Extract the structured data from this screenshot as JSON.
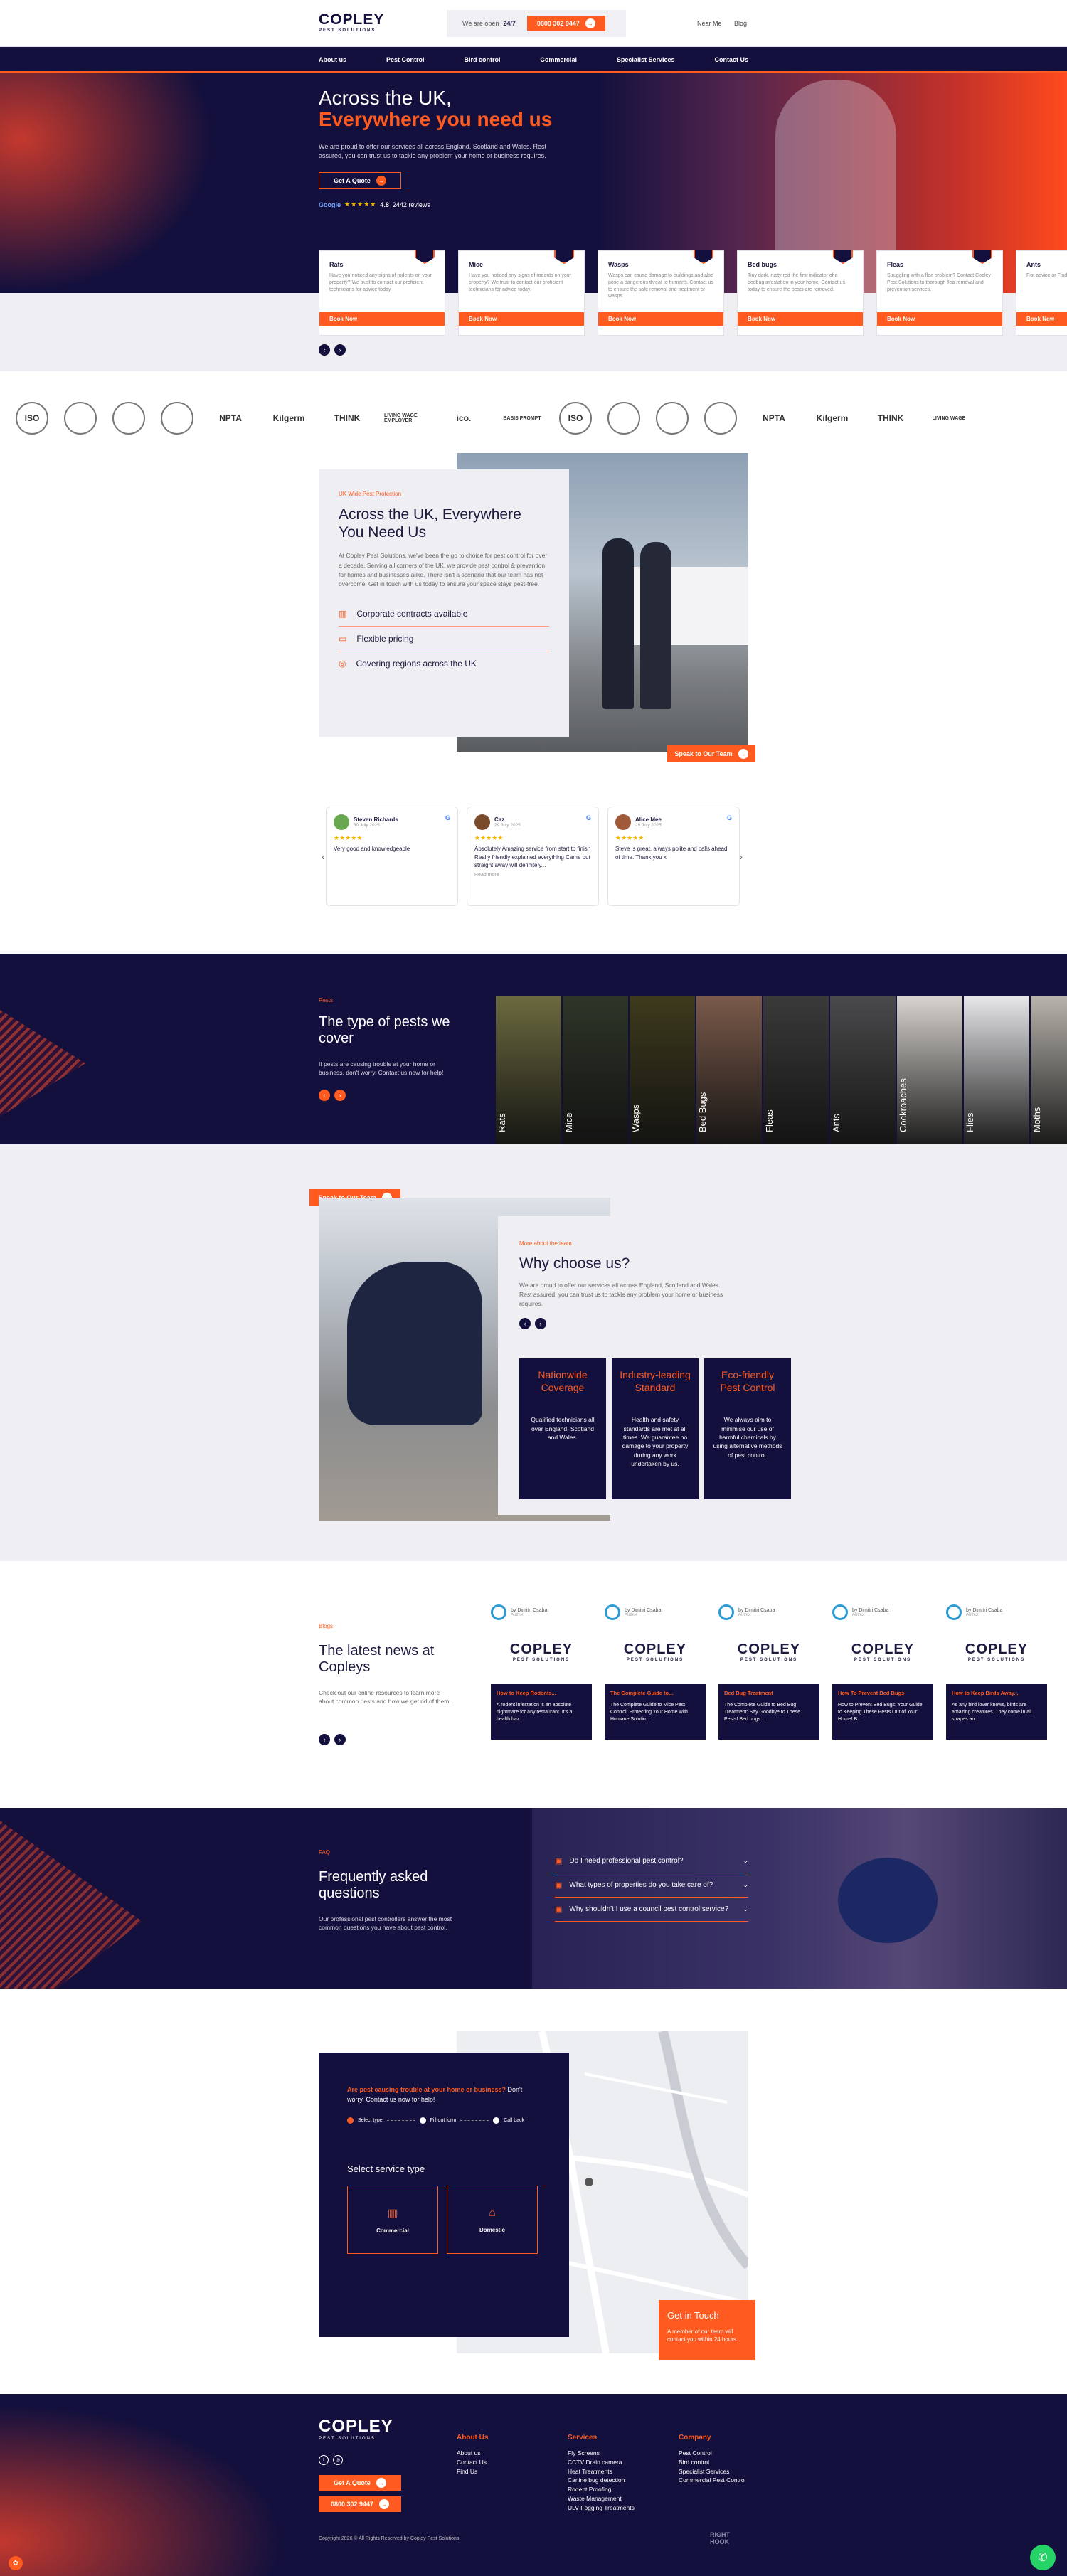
{
  "header": {
    "logo": "COPLEY",
    "logo_sub": "PEST SOLUTIONS",
    "open_pre": "We are open",
    "open_hours": "24/7",
    "phone": "0800 302 9447",
    "links": [
      "Near Me",
      "Blog"
    ]
  },
  "nav": [
    "About us",
    "Pest Control",
    "Bird control",
    "Commercial",
    "Specialist Services",
    "Contact Us"
  ],
  "hero": {
    "line1": "Across the UK,",
    "line2": "Everywhere you need us",
    "text": "We are proud to offer our services all across England, Scotland and Wales. Rest assured, you can trust us to tackle any problem your home or business requires.",
    "cta": "Get A Quote",
    "g": "Google",
    "rating": "4.8",
    "reviews": "2442 reviews"
  },
  "pest_cards": [
    {
      "title": "Rats",
      "text": "Have you noticed any signs of rodents on your property? We trust to contact our proficient technicians for advice today.",
      "btn": "Book Now"
    },
    {
      "title": "Mice",
      "text": "Have you noticed any signs of rodents on your property? We trust to contact our proficient technicians for advice today.",
      "btn": "Book Now"
    },
    {
      "title": "Wasps",
      "text": "Wasps can cause damage to buildings and also pose a dangerous threat to humans. Contact us to ensure the safe removal and treatment of wasps.",
      "btn": "Book Now"
    },
    {
      "title": "Bed bugs",
      "text": "Tiny dark, rusty red the first indicator of a bedbug infestation in your home. Contact us today to ensure the pests are removed.",
      "btn": "Book Now"
    },
    {
      "title": "Fleas",
      "text": "Struggling with a flea problem? Contact Copley Pest Solutions to thorough flea removal and prevention services.",
      "btn": "Book Now"
    },
    {
      "title": "Ants",
      "text": "Fist advice or Find your spac ants.",
      "btn": "Book Now"
    }
  ],
  "accreditations": [
    "ISO",
    "",
    "",
    "",
    "NPTA",
    "Kilgerm",
    "THINK",
    "LIVING WAGE EMPLOYER",
    "ico.",
    "BASIS PROMPT",
    "ISO",
    "",
    "",
    "",
    "NPTA",
    "Kilgerm",
    "THINK",
    "LIVING WAGE"
  ],
  "about": {
    "kicker": "UK Wide Pest Protection",
    "title": "Across the UK, Everywhere You Need Us",
    "text": "At Copley Pest Solutions, we've been the go to choice for pest control for over a decade. Serving all corners of the UK, we provide pest control & prevention for homes and businesses alike. There isn't a scenario that our team has not overcome. Get in touch with us today to ensure your space stays pest-free.",
    "features": [
      "Corporate contracts available",
      "Flexible pricing",
      "Covering regions across the UK"
    ],
    "cta": "Speak to Our Team"
  },
  "reviews": [
    {
      "name": "Steven Richards",
      "date": "30 July 2025",
      "text": "Very good and knowledgeable",
      "more": ""
    },
    {
      "name": "Caz",
      "date": "29 July 2025",
      "text": "Absolutely Amazing service from start to finish Really friendly explained everything Came out straight away will definitely...",
      "more": "Read more"
    },
    {
      "name": "Alice Mee",
      "date": "29 July 2025",
      "text": "Steve is great, always polite and calls ahead of time. Thank you x",
      "more": ""
    }
  ],
  "pests": {
    "kicker": "Pests",
    "title": "The type of pests we cover",
    "text": "If pests are causing trouble at your home or business, don't worry. Contact us now for help!",
    "items": [
      "Rats",
      "Mice",
      "Wasps",
      "Bed Bugs",
      "Fleas",
      "Ants",
      "Cockroaches",
      "Flies",
      "Moths"
    ]
  },
  "why": {
    "kicker": "More about the team",
    "title": "Why choose us?",
    "text": "We are proud to offer our services all across England, Scotland and Wales. Rest assured, you can trust us to tackle any problem your home or business requires.",
    "cta": "Speak to Our Team",
    "cards": [
      {
        "title": "Nationwide Coverage",
        "text": "Qualified technicians all over England, Scotland and Wales."
      },
      {
        "title": "Industry-leading Standard",
        "text": "Health and safety standards are met at all times. We guarantee no damage to your property during any work undertaken by us."
      },
      {
        "title": "Eco-friendly Pest Control",
        "text": "We always aim to minimise our use of harmful chemicals by using alternative methods of pest control."
      }
    ]
  },
  "blog": {
    "kicker": "Blogs",
    "title": "The latest news at Copleys",
    "text": "Check out our online resources to learn more about common pests and how we get rid of them.",
    "posts": [
      {
        "author": "by Dimitri Csaba",
        "role": "Author",
        "title": "How to Keep Rodents...",
        "text": "A rodent infestation is an absolute nightmare for any restaurant. It's a health haz..."
      },
      {
        "author": "by Dimitri Csaba",
        "role": "Author",
        "title": "The Complete Guide to...",
        "text": "The Complete Guide to Mice Pest Control: Protecting Your Home with Humane Solutio..."
      },
      {
        "author": "by Dimitri Csaba",
        "role": "Author",
        "title": "Bed Bug Treatment",
        "text": "The Complete Guide to Bed Bug Treatment: Say Goodbye to These Pests! Bed bugs ..."
      },
      {
        "author": "by Dimitri Csaba",
        "role": "Author",
        "title": "How To Prevent Bed Bugs",
        "text": "How to Prevent Bed Bugs: Your Guide to Keeping These Pests Out of Your Home! B..."
      },
      {
        "author": "by Dimitri Csaba",
        "role": "Author",
        "title": "How to Keep Birds Away...",
        "text": "As any bird lover knows, birds are amazing creatures. They come in all shapes an..."
      }
    ]
  },
  "faq": {
    "kicker": "FAQ",
    "title": "Frequently asked questions",
    "text": "Our professional pest controllers answer the most common questions you have about pest control.",
    "items": [
      "Do I need professional pest control?",
      "What types of properties do you take care of?",
      "Why shouldn't I use a council pest control service?"
    ]
  },
  "contact": {
    "lead_orange": "Are pest causing trouble at your home or business?",
    "lead_rest": " Don't worry. Contact us now for help!",
    "steps": [
      "Select type",
      "Fill out form",
      "Call back"
    ],
    "select_title": "Select service type",
    "options": [
      "Commercial",
      "Domestic"
    ],
    "git_title": "Get in Touch",
    "git_text": "A member of our team will contact you within 24 hours."
  },
  "footer": {
    "logo": "COPLEY",
    "logo_sub": "PEST SOLUTIONS",
    "quote": "Get A Quote",
    "phone": "0800 302 9447",
    "cols": [
      {
        "title": "About Us",
        "items": [
          "About us",
          "Contact Us",
          "Find Us"
        ]
      },
      {
        "title": "Services",
        "items": [
          "Fly Screens",
          "CCTV Drain camera",
          "Heat Treatments",
          "Canine bug detection",
          "Rodent Proofing",
          "Waste Management",
          "ULV Fogging Treatments"
        ]
      },
      {
        "title": "Company",
        "items": [
          "Pest Control",
          "Bird control",
          "Specialist Services",
          "Commercial Pest Control"
        ]
      }
    ],
    "copy": "Copyright 2026 © All Rights Reserved by Copley Pest Solutions",
    "credit": "RIGHT HOOK"
  },
  "colors": {
    "navy": "#13103d",
    "orange": "#ff5a1f"
  }
}
